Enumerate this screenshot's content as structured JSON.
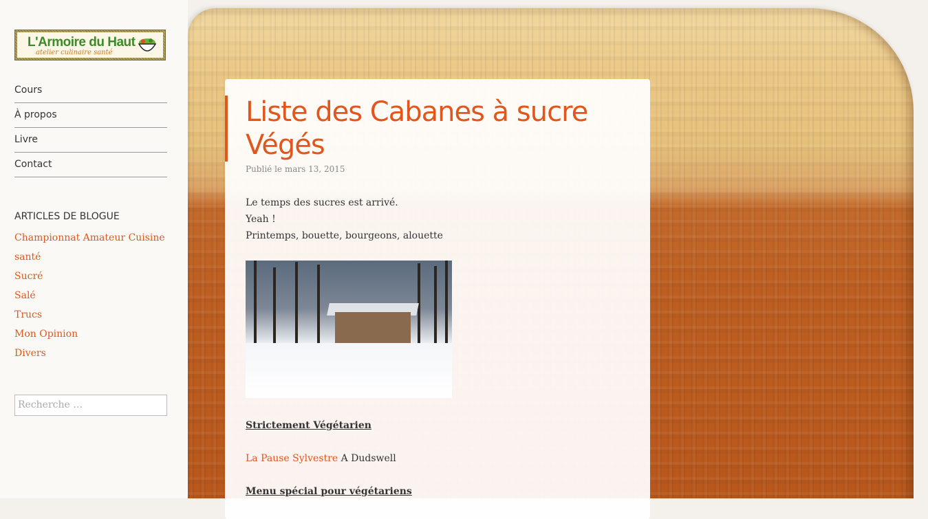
{
  "logo": {
    "title": "L'Armoire du Haut",
    "subtitle": "atelier culinaire santé"
  },
  "nav": {
    "items": [
      {
        "label": "Cours"
      },
      {
        "label": "À propos"
      },
      {
        "label": "Livre"
      },
      {
        "label": "Contact"
      }
    ]
  },
  "blog": {
    "title": "ARTICLES DE BLOGUE",
    "categories": [
      {
        "label": "Championnat Amateur Cuisine"
      },
      {
        "label": "santé"
      },
      {
        "label": "Sucré"
      },
      {
        "label": "Salé"
      },
      {
        "label": "Trucs"
      },
      {
        "label": "Mon Opinion"
      },
      {
        "label": "Divers"
      }
    ]
  },
  "search": {
    "placeholder": "Recherche …"
  },
  "article": {
    "title": "Liste des Cabanes à sucre Végés",
    "meta": "Publié le mars 13, 2015",
    "paragraphs": [
      "Le temps des sucres est arrivé.",
      "Yeah !",
      "Printemps, bouette, bourgeons, alouette"
    ],
    "section1": "Strictement Végétarien",
    "link_text": "La Pause Sylvestre",
    "link_suffix": " A Dudswell",
    "section2": "Menu spécial pour végétariens"
  },
  "colors": {
    "accent": "#e0561c",
    "text": "#333333"
  },
  "icons": {
    "logo_bowl": "salad-bowl-icon"
  }
}
